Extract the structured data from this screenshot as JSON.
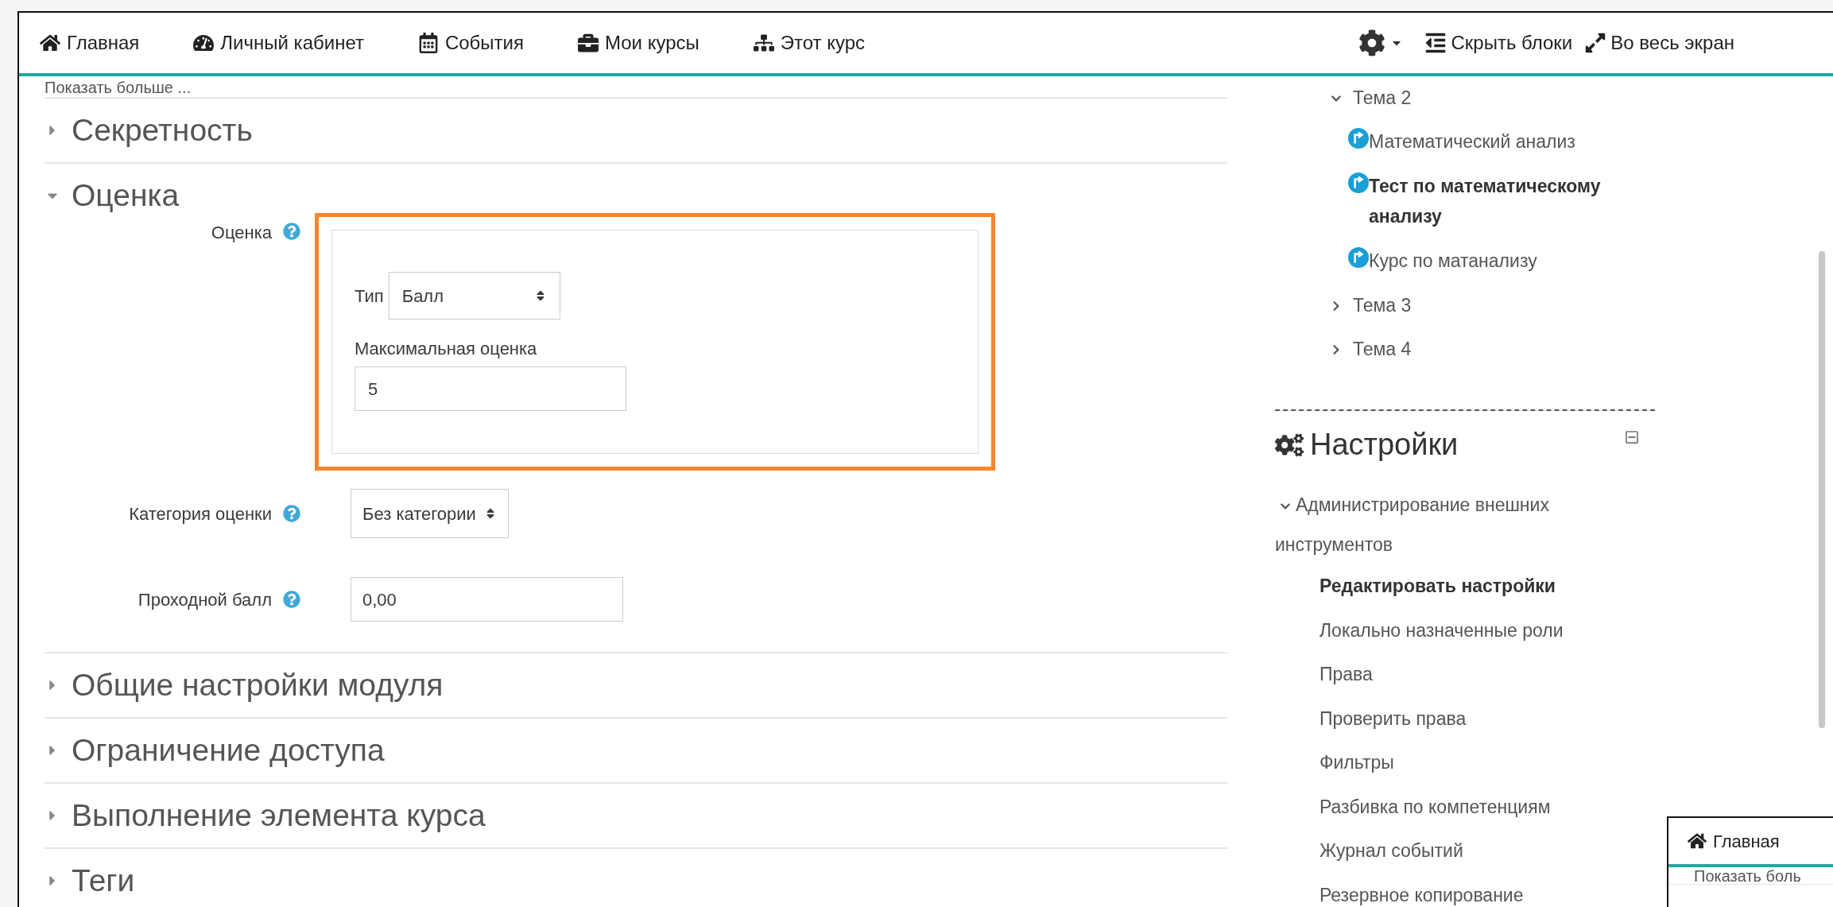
{
  "navbar": {
    "items": [
      {
        "kind": "home",
        "label": "Главная"
      },
      {
        "kind": "dashboard",
        "label": "Личный кабинет"
      },
      {
        "kind": "calendar",
        "label": "События"
      },
      {
        "kind": "briefcase",
        "label": "Мои курсы"
      },
      {
        "kind": "sitemap",
        "label": "Этот курс"
      }
    ],
    "actions": [
      {
        "kind": "hide",
        "label": "Скрыть блоки"
      },
      {
        "kind": "fullscreen",
        "label": "Во весь экран"
      }
    ]
  },
  "show_more": "Показать больше ...",
  "sections": [
    {
      "title": "Секретность",
      "expanded": false
    },
    {
      "title": "Оценка",
      "expanded": true,
      "fields": [
        {
          "kind": "group",
          "label": "Оценка",
          "highlighted": true,
          "type_label": "Тип",
          "type_value": "Балл",
          "max_label": "Максимальная оценка",
          "max_value": "5"
        },
        {
          "kind": "select",
          "label": "Категория оценки",
          "value": "Без категории"
        },
        {
          "kind": "input",
          "label": "Проходной балл",
          "value": "0,00"
        }
      ]
    },
    {
      "title": "Общие настройки модуля",
      "expanded": false
    },
    {
      "title": "Ограничение доступа",
      "expanded": false
    },
    {
      "title": "Выполнение элемента курса",
      "expanded": false
    },
    {
      "title": "Теги",
      "expanded": false
    }
  ],
  "course_tree": [
    {
      "label": "Тема 2",
      "expanded": true,
      "children": [
        {
          "label": "Математический анализ",
          "selected": false
        },
        {
          "label": "Тест по математическому анализу",
          "selected": true
        },
        {
          "label": "Курс по матанализу",
          "selected": false
        }
      ]
    },
    {
      "label": "Тема 3",
      "expanded": false
    },
    {
      "label": "Тема 4",
      "expanded": false
    }
  ],
  "settings_block": {
    "title": "Настройки",
    "node": {
      "label": "Администрирование внешних инструментов",
      "expanded": true,
      "children": [
        {
          "label": "Редактировать настройки",
          "selected": true
        },
        {
          "label": "Локально назначенные роли",
          "selected": false
        },
        {
          "label": "Права",
          "selected": false
        },
        {
          "label": "Проверить права",
          "selected": false
        },
        {
          "label": "Фильтры",
          "selected": false
        },
        {
          "label": "Разбивка по компетенциям",
          "selected": false
        },
        {
          "label": "Журнал событий",
          "selected": false
        },
        {
          "label": "Резервное копирование",
          "selected": false
        }
      ]
    }
  },
  "thumbnail": {
    "nav_label": "Главная",
    "text": "Показать боль"
  }
}
